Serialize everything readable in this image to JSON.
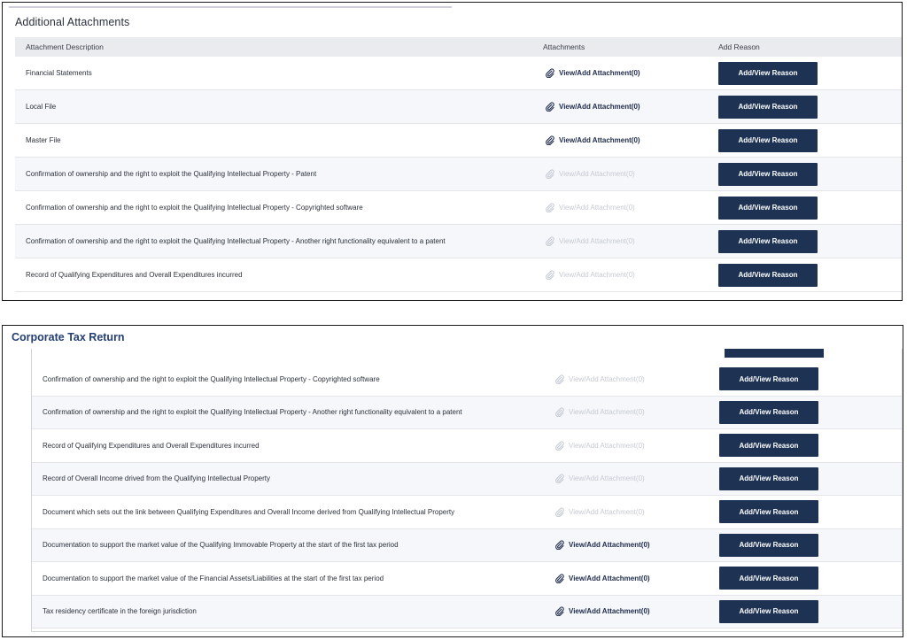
{
  "top_panel": {
    "section_title": "Additional Attachments",
    "columns": {
      "description": "Attachment Description",
      "attachments": "Attachments",
      "reason": "Add Reason"
    },
    "rows": [
      {
        "description": "Financial Statements",
        "attachment_label": "View/Add Attachment(0)",
        "attachment_enabled": true,
        "reason_label": "Add/View Reason"
      },
      {
        "description": "Local File",
        "attachment_label": "View/Add Attachment(0)",
        "attachment_enabled": true,
        "reason_label": "Add/View Reason"
      },
      {
        "description": "Master File",
        "attachment_label": "View/Add Attachment(0)",
        "attachment_enabled": true,
        "reason_label": "Add/View Reason"
      },
      {
        "description": "Confirmation of ownership and the right to exploit the Qualifying Intellectual Property - Patent",
        "attachment_label": "View/Add Attachment(0)",
        "attachment_enabled": false,
        "reason_label": "Add/View Reason"
      },
      {
        "description": "Confirmation of ownership and the right to exploit the Qualifying Intellectual Property - Copyrighted software",
        "attachment_label": "View/Add Attachment(0)",
        "attachment_enabled": false,
        "reason_label": "Add/View Reason"
      },
      {
        "description": "Confirmation of ownership and the right to exploit the Qualifying Intellectual Property - Another right functionality equivalent to a patent",
        "attachment_label": "View/Add Attachment(0)",
        "attachment_enabled": false,
        "reason_label": "Add/View Reason"
      },
      {
        "description": "Record of Qualifying Expenditures and Overall Expenditures incurred",
        "attachment_label": "View/Add Attachment(0)",
        "attachment_enabled": false,
        "reason_label": "Add/View Reason"
      }
    ]
  },
  "bottom_panel": {
    "page_title": "Corporate Tax Return",
    "rows": [
      {
        "description": "Confirmation of ownership and the right to exploit the Qualifying Intellectual Property - Copyrighted software",
        "attachment_label": "View/Add Attachment(0)",
        "attachment_enabled": false,
        "reason_label": "Add/View Reason"
      },
      {
        "description": "Confirmation of ownership and the right to exploit the Qualifying Intellectual Property - Another right functionality equivalent to a patent",
        "attachment_label": "View/Add Attachment(0)",
        "attachment_enabled": false,
        "reason_label": "Add/View Reason"
      },
      {
        "description": "Record of Qualifying Expenditures and Overall Expenditures incurred",
        "attachment_label": "View/Add Attachment(0)",
        "attachment_enabled": false,
        "reason_label": "Add/View Reason"
      },
      {
        "description": "Record of Overall Income drived from the Qualifying Intellectual Property",
        "attachment_label": "View/Add Attachment(0)",
        "attachment_enabled": false,
        "reason_label": "Add/View Reason"
      },
      {
        "description": "Document which sets out the link between Qualifying Expenditures and Overall Income derived from Qualifying Intellectual Property",
        "attachment_label": "View/Add Attachment(0)",
        "attachment_enabled": false,
        "reason_label": "Add/View Reason"
      },
      {
        "description": "Documentation to support the market value of the Qualifying Immovable Property at the start of the first tax period",
        "attachment_label": "View/Add Attachment(0)",
        "attachment_enabled": true,
        "reason_label": "Add/View Reason"
      },
      {
        "description": "Documentation to support the market value of the Financial Assets/Liabilities at the start of the first tax period",
        "attachment_label": "View/Add Attachment(0)",
        "attachment_enabled": true,
        "reason_label": "Add/View Reason"
      },
      {
        "description": "Tax residency certificate in the foreign jurisdiction",
        "attachment_label": "View/Add Attachment(0)",
        "attachment_enabled": true,
        "reason_label": "Add/View Reason"
      }
    ]
  },
  "colors": {
    "button_bg": "#1e3354",
    "title_blue": "#243f73",
    "link_enabled": "#1d2a4a",
    "link_disabled": "#c6cad3",
    "header_bg": "#eaebef"
  },
  "icons": {
    "attachment": "paperclip-icon"
  }
}
